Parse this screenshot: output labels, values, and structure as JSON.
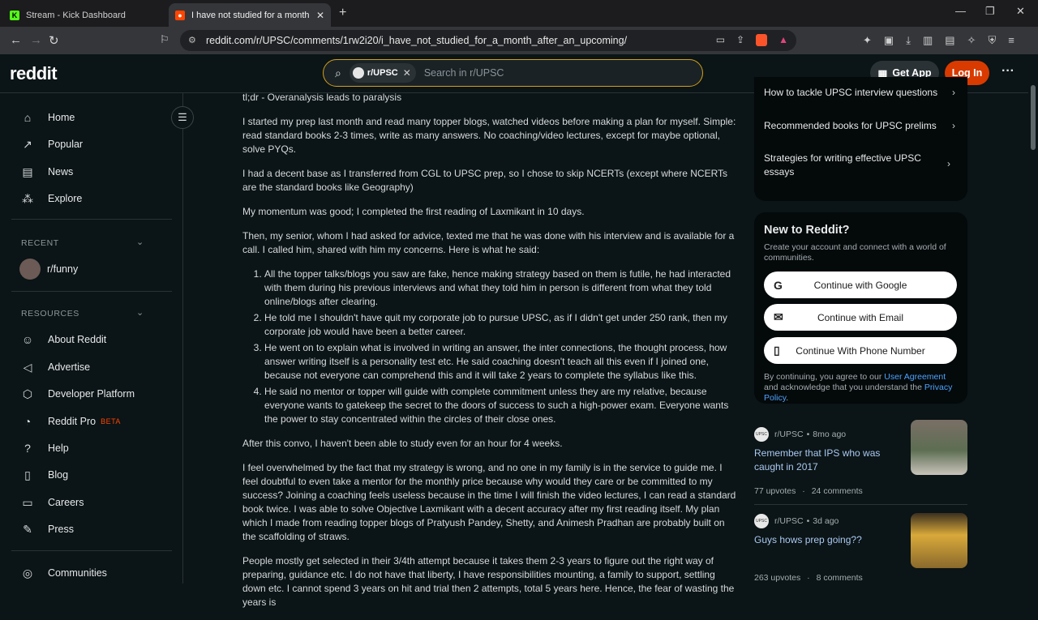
{
  "browser": {
    "tabs": [
      {
        "title": "Stream - Kick Dashboard",
        "active": false
      },
      {
        "title": "I have not studied for a month af",
        "active": true
      }
    ],
    "url": "reddit.com/r/UPSC/comments/1rw2i20/i_have_not_studied_for_a_month_after_an_upcoming/"
  },
  "header": {
    "logo": "reddit",
    "search_chip": "r/UPSC",
    "search_placeholder": "Search in r/UPSC",
    "get_app": "Get App",
    "login": "Log In"
  },
  "sidebar": {
    "items": [
      {
        "label": "Home",
        "icon": "home-icon"
      },
      {
        "label": "Popular",
        "icon": "popular-icon"
      },
      {
        "label": "News",
        "icon": "news-icon"
      },
      {
        "label": "Explore",
        "icon": "explore-icon"
      }
    ],
    "recent_header": "RECENT",
    "recent": [
      {
        "label": "r/funny"
      }
    ],
    "resources_header": "RESOURCES",
    "resources": [
      {
        "label": "About Reddit",
        "icon": "about-icon"
      },
      {
        "label": "Advertise",
        "icon": "megaphone-icon"
      },
      {
        "label": "Developer Platform",
        "icon": "developer-icon"
      },
      {
        "label": "Reddit Pro",
        "badge": "BETA",
        "icon": "pro-icon"
      },
      {
        "label": "Help",
        "icon": "help-icon"
      },
      {
        "label": "Blog",
        "icon": "blog-icon"
      },
      {
        "label": "Careers",
        "icon": "careers-icon"
      },
      {
        "label": "Press",
        "icon": "press-icon"
      }
    ],
    "communities": "Communities"
  },
  "post": {
    "p0": "tl;dr - Overanalysis leads to paralysis",
    "p1": "I started my prep last month and read many topper blogs, watched videos before making a plan for myself. Simple: read standard books 2-3 times, write as many answers. No coaching/video lectures, except for maybe optional, solve PYQs.",
    "p2": "I had a decent base as I transferred from CGL to UPSC prep, so I chose to skip NCERTs (except where NCERTs are the standard books like Geography)",
    "p3": "My momentum was good; I completed the first reading of Laxmikant in 10 days.",
    "p4": "Then, my senior, whom I had asked for advice, texted me that he was done with his interview and is available for a call. I called him, shared with him my concerns. Here is what he said:",
    "list": [
      "All the topper talks/blogs you saw are fake, hence making strategy based on them is futile, he had interacted with them during his previous interviews and what they told him in person is different from what they told online/blogs after clearing.",
      "He told me I shouldn't have quit my corporate job to pursue UPSC, as if I didn't get under 250 rank, then my corporate job would have been a better career.",
      "He went on to explain what is involved in writing an answer, the inter connections, the thought process, how answer writing itself is a personality test etc. He said coaching doesn't teach all this even if I joined one, because not everyone can comprehend this and it will take 2 years to complete the syllabus like this.",
      "He said no mentor or topper will guide with complete commitment unless they are my relative, because everyone wants to gatekeep the secret to the doors of success to such a high-power exam. Everyone wants the power to stay concentrated within the circles of their close ones."
    ],
    "p5": "After this convo, I haven't been able to study even for an hour for 4 weeks.",
    "p6": "I feel overwhelmed by the fact that my strategy is wrong, and no one in my family is in the service to guide me. I feel doubtful to even take a mentor for the monthly price because why would they care or be committed to my success? Joining a coaching feels useless because in the time I will finish the video lectures, I can read a standard book twice. I was able to solve Objective Laxmikant with a decent accuracy after my first reading itself. My plan which I made from reading topper blogs of Pratyush Pandey, Shetty, and Animesh Pradhan are probably built on the scaffolding of straws.",
    "p7": "People mostly get selected in their 3/4th attempt because it takes them 2-3 years to figure out the right way of preparing, guidance etc. I do not have that liberty, I have responsibilities mounting, a family to support, settling down etc. I cannot spend 3 years on hit and trial then 2 attempts, total 5 years here. Hence, the fear of wasting the years is"
  },
  "related": [
    {
      "label": "How to tackle UPSC interview questions"
    },
    {
      "label": "Recommended books for UPSC prelims"
    },
    {
      "label": "Strategies for writing effective UPSC essays"
    }
  ],
  "new_to_reddit": {
    "title": "New to Reddit?",
    "subtitle": "Create your account and connect with a world of communities.",
    "google": "Continue with Google",
    "email": "Continue with Email",
    "phone": "Continue With Phone Number",
    "legal_pre": "By continuing, you agree to our ",
    "legal_link1": "User Agreement",
    "legal_mid": " and acknowledge that you understand the ",
    "legal_link2": "Privacy Policy",
    "legal_post": "."
  },
  "posts": [
    {
      "sub": "r/UPSC",
      "age": "8mo ago",
      "title": "Remember that IPS who was caught in 2017",
      "upvotes": "77 upvotes",
      "comments": "24 comments"
    },
    {
      "sub": "r/UPSC",
      "age": "3d ago",
      "title": "Guys hows prep going??",
      "upvotes": "263 upvotes",
      "comments": "8 comments"
    }
  ],
  "colors": {
    "accent": "#ff4500",
    "login": "#d93a00",
    "search_border": "#d4a017",
    "link": "#4ea3ff"
  }
}
